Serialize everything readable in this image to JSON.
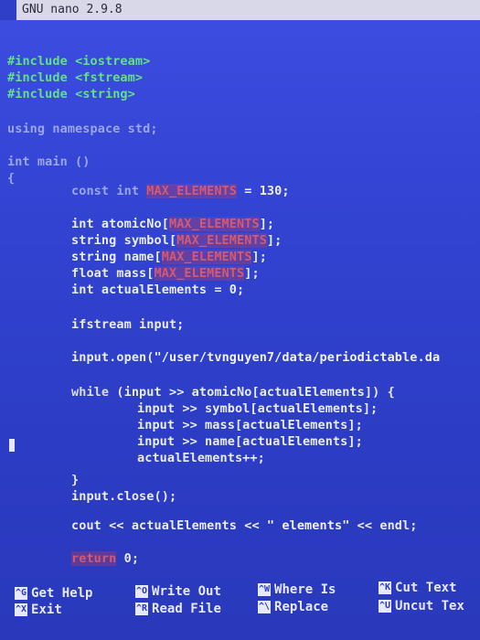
{
  "app": {
    "title": "GNU nano 2.9.8"
  },
  "code": {
    "line1": {
      "prefix": "#include ",
      "arg": "<iostream>"
    },
    "line2": {
      "prefix": "#include ",
      "arg": "<fstream>"
    },
    "line3": {
      "prefix": "#include ",
      "arg": "<string>"
    },
    "line4": {
      "text": "using namespace std;"
    },
    "line5": {
      "text": "int main ()"
    },
    "line6": {
      "text": "{"
    },
    "line7": {
      "p1": "const int ",
      "name": "MAX_ELEMENTS",
      "p2": " = 130;"
    },
    "line8": {
      "p1": "int atomicNo[",
      "name": "MAX_ELEMENTS",
      "p2": "];"
    },
    "line9": {
      "p1": "string symbol[",
      "name": "MAX_ELEMENTS",
      "p2": "];"
    },
    "line10": {
      "p1": "string name[",
      "name": "MAX_ELEMENTS",
      "p2": "];"
    },
    "line11": {
      "p1": "float mass[",
      "name": "MAX_ELEMENTS",
      "p2": "];"
    },
    "line12": {
      "text": "int actualElements = 0;"
    },
    "line13": {
      "text": "ifstream input;"
    },
    "line14": {
      "p1": "input.open(",
      "str": "\"/user/tvnguyen7/data/periodictable.da"
    },
    "line15": {
      "kw": "while",
      "p2": " (input >> atomicNo[actualElements]) {"
    },
    "line16": {
      "text": "input >> symbol[actualElements];"
    },
    "line17": {
      "text": "input >> mass[actualElements];"
    },
    "line18": {
      "text": "input >> name[actualElements];"
    },
    "line19": {
      "text": "actualElements++;"
    },
    "line20": {
      "text": "}"
    },
    "line21": {
      "text": "input.close();"
    },
    "line22": {
      "p1": "cout << actualElements << ",
      "str": "\" elements\"",
      "p2": " << endl;"
    },
    "line23": {
      "kw": "return",
      "p2": " 0;"
    }
  },
  "footer": {
    "items": [
      {
        "key": "^G",
        "label": "Get Help"
      },
      {
        "key": "^O",
        "label": "Write Out"
      },
      {
        "key": "^W",
        "label": "Where Is"
      },
      {
        "key": "^K",
        "label": "Cut Text"
      },
      {
        "key": "^X",
        "label": "Exit"
      },
      {
        "key": "^R",
        "label": "Read File"
      },
      {
        "key": "^\\",
        "label": "Replace"
      },
      {
        "key": "^U",
        "label": "Uncut Tex"
      }
    ]
  },
  "colors": {
    "background": "#2f3fc8",
    "include": "#62e08a",
    "macro": "#d25a72",
    "text": "#e8ecff"
  }
}
